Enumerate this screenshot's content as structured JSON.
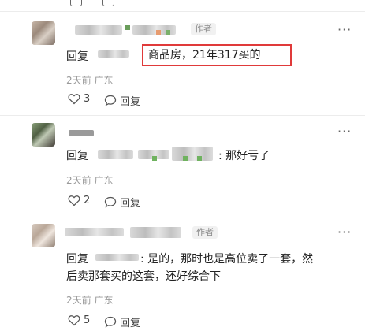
{
  "comments": [
    {
      "author_badge": "作者",
      "reply_prefix": "回复",
      "highlighted_text": "商品房，21年317买的",
      "meta": "2天前 广东",
      "likes": "3",
      "reply_label": "回复"
    },
    {
      "reply_prefix": "回复",
      "text": ": 那好亏了",
      "meta": "2天前 广东",
      "likes": "2",
      "reply_label": "回复"
    },
    {
      "author_badge": "作者",
      "reply_prefix": "回复",
      "text_line1": ": 是的，那时也是高位卖了一套，然",
      "text_line2": "后卖那套买的这套，还好综合下",
      "meta": "2天前 广东",
      "likes": "5",
      "reply_label": "回复"
    }
  ],
  "icons": [
    "heart-icon",
    "comment-icon",
    "more-icon"
  ],
  "colors": {
    "highlight_border": "#e03a3a",
    "meta_text": "#9a9a9a"
  }
}
